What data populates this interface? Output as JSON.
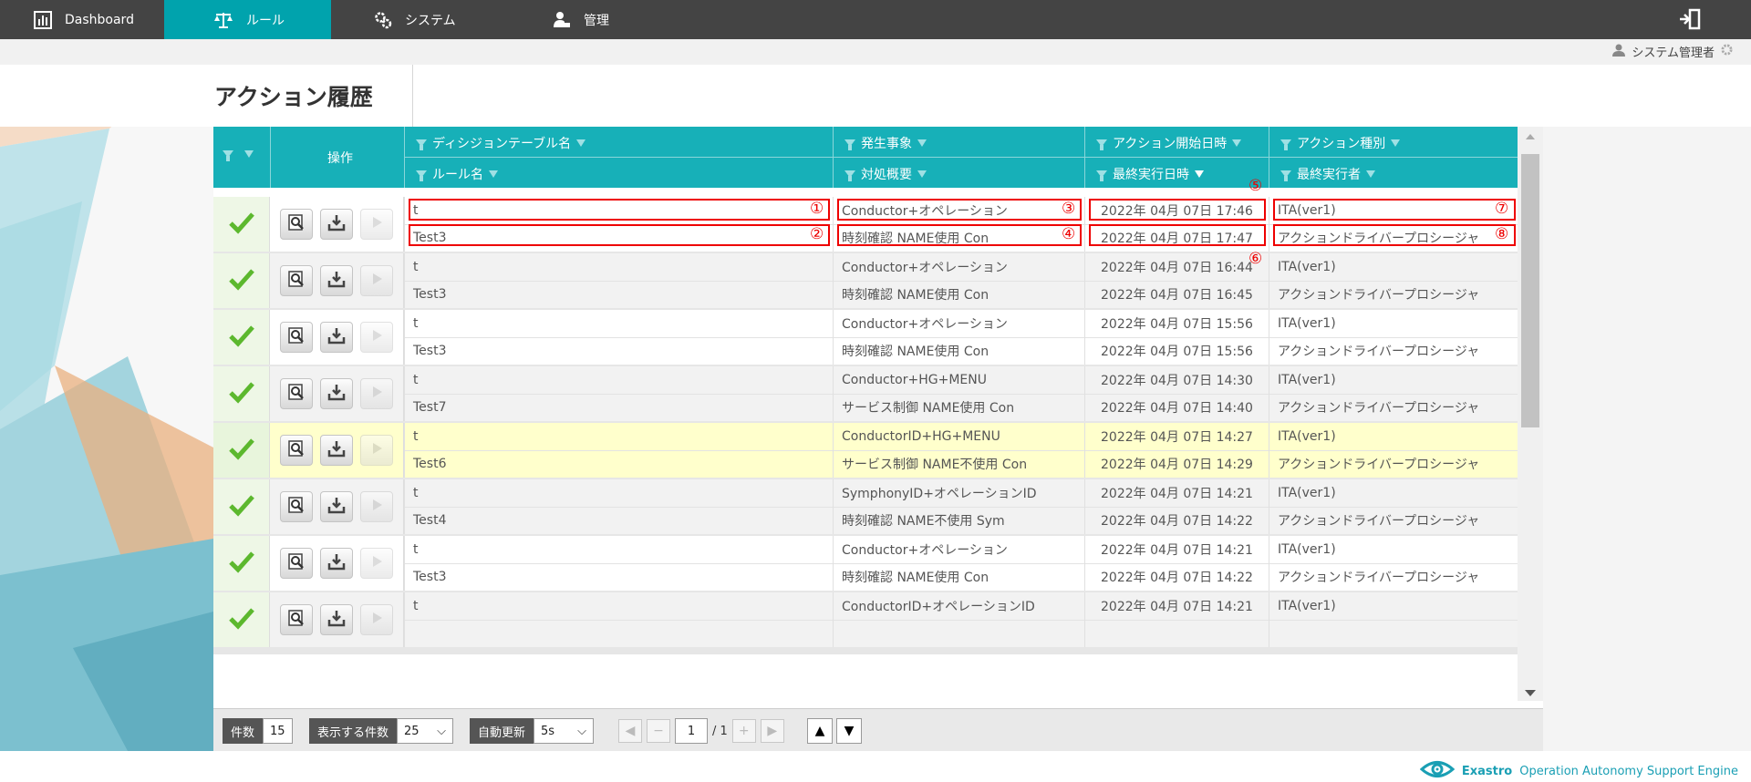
{
  "nav": {
    "dashboard": "Dashboard",
    "rules": "ルール",
    "system": "システム",
    "admin": "管理"
  },
  "user": {
    "name": "システム管理者"
  },
  "page": {
    "title": "アクション履歴"
  },
  "table": {
    "headers": {
      "ops": "操作",
      "decision_table": "ディシジョンテーブル名",
      "event": "発生事象",
      "action_start": "アクション開始日時",
      "action_type": "アクション種別",
      "rule_name": "ルール名",
      "handling": "対処概要",
      "last_exec": "最終実行日時",
      "last_executor": "最終実行者"
    },
    "rows": [
      {
        "decision_table": "t",
        "rule": "Test3",
        "event": "Conductor+オペレーション",
        "handling": "時刻確認 NAME使用 Con",
        "start": "2022年 04月 07日 17:46",
        "last_exec": "2022年 04月 07日 17:47",
        "type": "ITA(ver1)",
        "executor": "アクションドライバープロシージャ",
        "bg": "#ffffff"
      },
      {
        "decision_table": "t",
        "rule": "Test3",
        "event": "Conductor+オペレーション",
        "handling": "時刻確認 NAME使用 Con",
        "start": "2022年 04月 07日 16:44",
        "last_exec": "2022年 04月 07日 16:45",
        "type": "ITA(ver1)",
        "executor": "アクションドライバープロシージャ",
        "bg": "#f2f2f2"
      },
      {
        "decision_table": "t",
        "rule": "Test3",
        "event": "Conductor+オペレーション",
        "handling": "時刻確認 NAME使用 Con",
        "start": "2022年 04月 07日 15:56",
        "last_exec": "2022年 04月 07日 15:56",
        "type": "ITA(ver1)",
        "executor": "アクションドライバープロシージャ",
        "bg": "#ffffff"
      },
      {
        "decision_table": "t",
        "rule": "Test7",
        "event": "Conductor+HG+MENU",
        "handling": "サービス制御 NAME使用 Con",
        "start": "2022年 04月 07日 14:30",
        "last_exec": "2022年 04月 07日 14:40",
        "type": "ITA(ver1)",
        "executor": "アクションドライバープロシージャ",
        "bg": "#f2f2f2"
      },
      {
        "decision_table": "t",
        "rule": "Test6",
        "event": "ConductorID+HG+MENU",
        "handling": "サービス制御 NAME不使用 Con",
        "start": "2022年 04月 07日 14:27",
        "last_exec": "2022年 04月 07日 14:29",
        "type": "ITA(ver1)",
        "executor": "アクションドライバープロシージャ",
        "bg": "#ffffcc"
      },
      {
        "decision_table": "t",
        "rule": "Test4",
        "event": "SymphonyID+オペレーションID",
        "handling": "時刻確認 NAME不使用 Sym",
        "start": "2022年 04月 07日 14:21",
        "last_exec": "2022年 04月 07日 14:22",
        "type": "ITA(ver1)",
        "executor": "アクションドライバープロシージャ",
        "bg": "#f2f2f2"
      },
      {
        "decision_table": "t",
        "rule": "Test3",
        "event": "Conductor+オペレーション",
        "handling": "時刻確認 NAME使用 Con",
        "start": "2022年 04月 07日 14:21",
        "last_exec": "2022年 04月 07日 14:22",
        "type": "ITA(ver1)",
        "executor": "アクションドライバープロシージャ",
        "bg": "#ffffff"
      },
      {
        "decision_table": "t",
        "rule": "",
        "event": "ConductorID+オペレーションID",
        "handling": "",
        "start": "2022年 04月 07日 14:21",
        "last_exec": "",
        "type": "ITA(ver1)",
        "executor": "",
        "bg": "#f2f2f2"
      }
    ]
  },
  "annotations": [
    "①",
    "②",
    "③",
    "④",
    "⑤",
    "⑥",
    "⑦",
    "⑧"
  ],
  "footer": {
    "count_label": "件数",
    "count": "15",
    "per_page_label": "表示する件数",
    "per_page": "25",
    "refresh_label": "自動更新",
    "refresh": "5s",
    "page": "1",
    "total_pages": "/ 1"
  },
  "brand": {
    "name": "Exastro",
    "product": "Operation Autonomy Support Engine"
  },
  "colors": {
    "header": "#17b0b8",
    "nav_active": "#00a3ad",
    "topbar": "#444444",
    "check": "#5cb82e",
    "highlight": "#e00000"
  }
}
